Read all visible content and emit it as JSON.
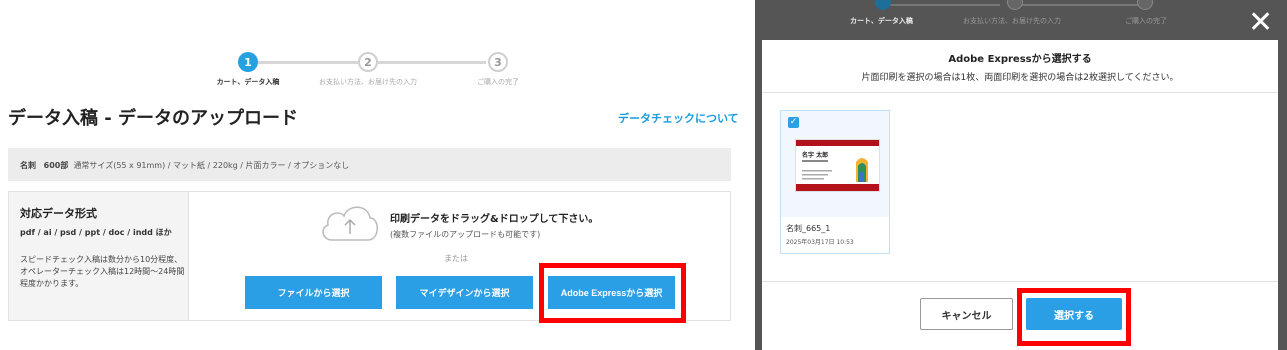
{
  "steps": [
    {
      "num": "1",
      "label": "カート、データ入稿"
    },
    {
      "num": "2",
      "label": "お支払い方法、お届け先の入力"
    },
    {
      "num": "3",
      "label": "ご購入の完了"
    }
  ],
  "page": {
    "title": "データ入稿 - データのアップロード",
    "check_link": "データチェックについて"
  },
  "order": {
    "product": "名刺",
    "quantity": "600部",
    "spec": "通常サイズ(55 x 91mm) / マット紙 / 220kg / 片面カラー / オプションなし"
  },
  "formats": {
    "title": "対応データ形式",
    "list": "pdf / ai / psd / ppt / doc / indd ほか",
    "note": "スピードチェック入稿は数分から10分程度、オペレーターチェック入稿は12時間〜24時間程度かかります。"
  },
  "upload": {
    "drop_title": "印刷データをドラッグ&ドロップして下さい。",
    "drop_sub": "(複数ファイルのアップロードも可能です)",
    "or": "または",
    "btn_file": "ファイルから選択",
    "btn_mydesign": "マイデザインから選択",
    "btn_adobe": "Adobe Expressから選択",
    "upload_icon": "cloud-upload-icon"
  },
  "modal": {
    "title": "Adobe Expressから選択する",
    "subtitle": "片面印刷を選択の場合は1枚、両面印刷を選択の場合は2枚選択してください。",
    "item": {
      "name": "名刺_665_1",
      "date": "2025年03月17日 10:53",
      "selected": true
    },
    "card_preview": {
      "name": "名字 太郎"
    },
    "cancel": "キャンセル",
    "select": "選択する",
    "close_icon": "close-icon"
  },
  "colors": {
    "accent": "#2a9fe6",
    "highlight": "#ff0000",
    "overlay": "#555555"
  }
}
